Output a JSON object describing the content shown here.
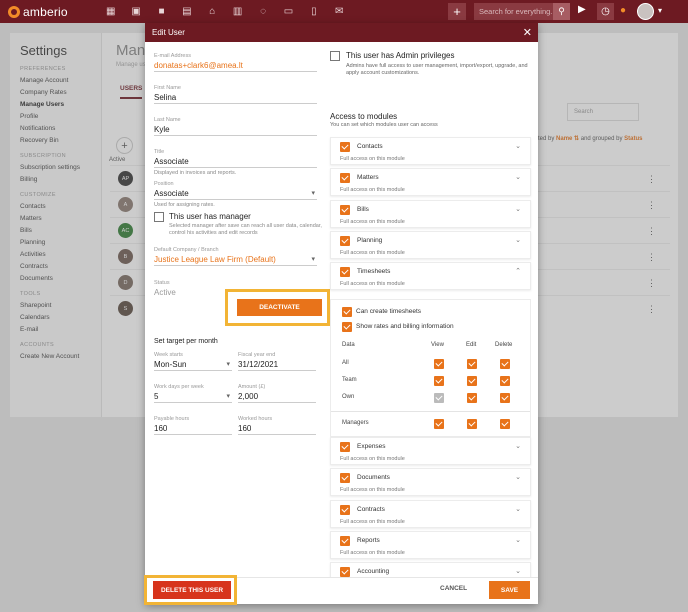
{
  "app": {
    "brand": "amberio",
    "search_placeholder": "Search for everything..."
  },
  "settings": {
    "title": "Settings",
    "page_title": "Mana",
    "page_sub": "Manage us",
    "tab": "USERS",
    "active_label": "Active",
    "search_placeholder": "Search",
    "sort_prefix": "ted by",
    "sort_field": "Name",
    "group_prefix": "and grouped by",
    "group_field": "Status",
    "sections": [
      {
        "title": "PREFERENCES",
        "items": [
          "Manage Account",
          "Company Rates",
          "Manage Users",
          "Profile",
          "Notifications",
          "Recovery Bin"
        ]
      },
      {
        "title": "SUBSCRIPTION",
        "items": [
          "Subscription settings",
          "Billing"
        ]
      },
      {
        "title": "CUSTOMIZE",
        "items": [
          "Contacts",
          "Matters",
          "Bills",
          "Planning",
          "Activities",
          "Contracts",
          "Documents"
        ]
      },
      {
        "title": "TOOLS",
        "items": [
          "Sharepoint",
          "Calendars",
          "E-mail"
        ]
      },
      {
        "title": "ACCOUNTS",
        "items": [
          "Create New Account"
        ]
      }
    ],
    "rows": [
      "AP",
      "A",
      "AC",
      "B",
      "D",
      "S"
    ]
  },
  "modal": {
    "title": "Edit User",
    "email_label": "E-mail Address",
    "email": "donatas+clark6@amea.lt",
    "first_name_label": "First Name",
    "first_name": "Selina",
    "last_name_label": "Last Name",
    "last_name": "Kyle",
    "title_label": "Title",
    "title_value": "Associate",
    "title_hint": "Displayed in invoices and reports.",
    "position_label": "Position",
    "position_value": "Associate",
    "position_hint": "Used for assigning rates.",
    "manager_label": "This user has manager",
    "manager_hint": "Selected manager after save can reach all user data, calendar, control his activities and edit records",
    "company_label": "Default Company / Branch",
    "company_value": "Justice League Law Firm (Default)",
    "status_label": "Status",
    "status_value": "Active",
    "deactivate": "DEACTIVATE",
    "target_title": "Set target per month",
    "week_starts_label": "Week starts",
    "week_starts": "Mon-Sun",
    "fiscal_label": "Fiscal year end",
    "fiscal": "31/12/2021",
    "wdays_label": "Work days per week",
    "wdays": "5",
    "amount_label": "Amount (£)",
    "amount": "2,000",
    "payable_label": "Payable hours",
    "payable": "160",
    "worked_label": "Worked hours",
    "worked": "160",
    "admin_label": "This user has Admin privileges",
    "admin_hint": "Admins have full access to user management, import/export, upgrade, and apply account customizations.",
    "access_title": "Access to modules",
    "access_sub": "You can set which modules user can access",
    "full_access": "Full access on this module",
    "modules_top": [
      "Contacts",
      "Matters",
      "Bills",
      "Planning",
      "Timesheets"
    ],
    "modules_bottom": [
      "Expenses",
      "Documents",
      "Contracts",
      "Reports",
      "Accounting"
    ],
    "ts_opt1": "Can create timesheets",
    "ts_opt2": "Show rates and billing information",
    "grid_data": "Data",
    "grid_view": "View",
    "grid_edit": "Edit",
    "grid_delete": "Delete",
    "grid_all": "All",
    "grid_team": "Team",
    "grid_own": "Own",
    "grid_managers": "Managers",
    "delete": "DELETE THIS USER",
    "cancel": "CANCEL",
    "save": "SAVE"
  },
  "colors": {
    "brand": "#6d1a22",
    "accent": "#e8731a",
    "danger": "#d7341c",
    "highlight": "#f2b435"
  }
}
